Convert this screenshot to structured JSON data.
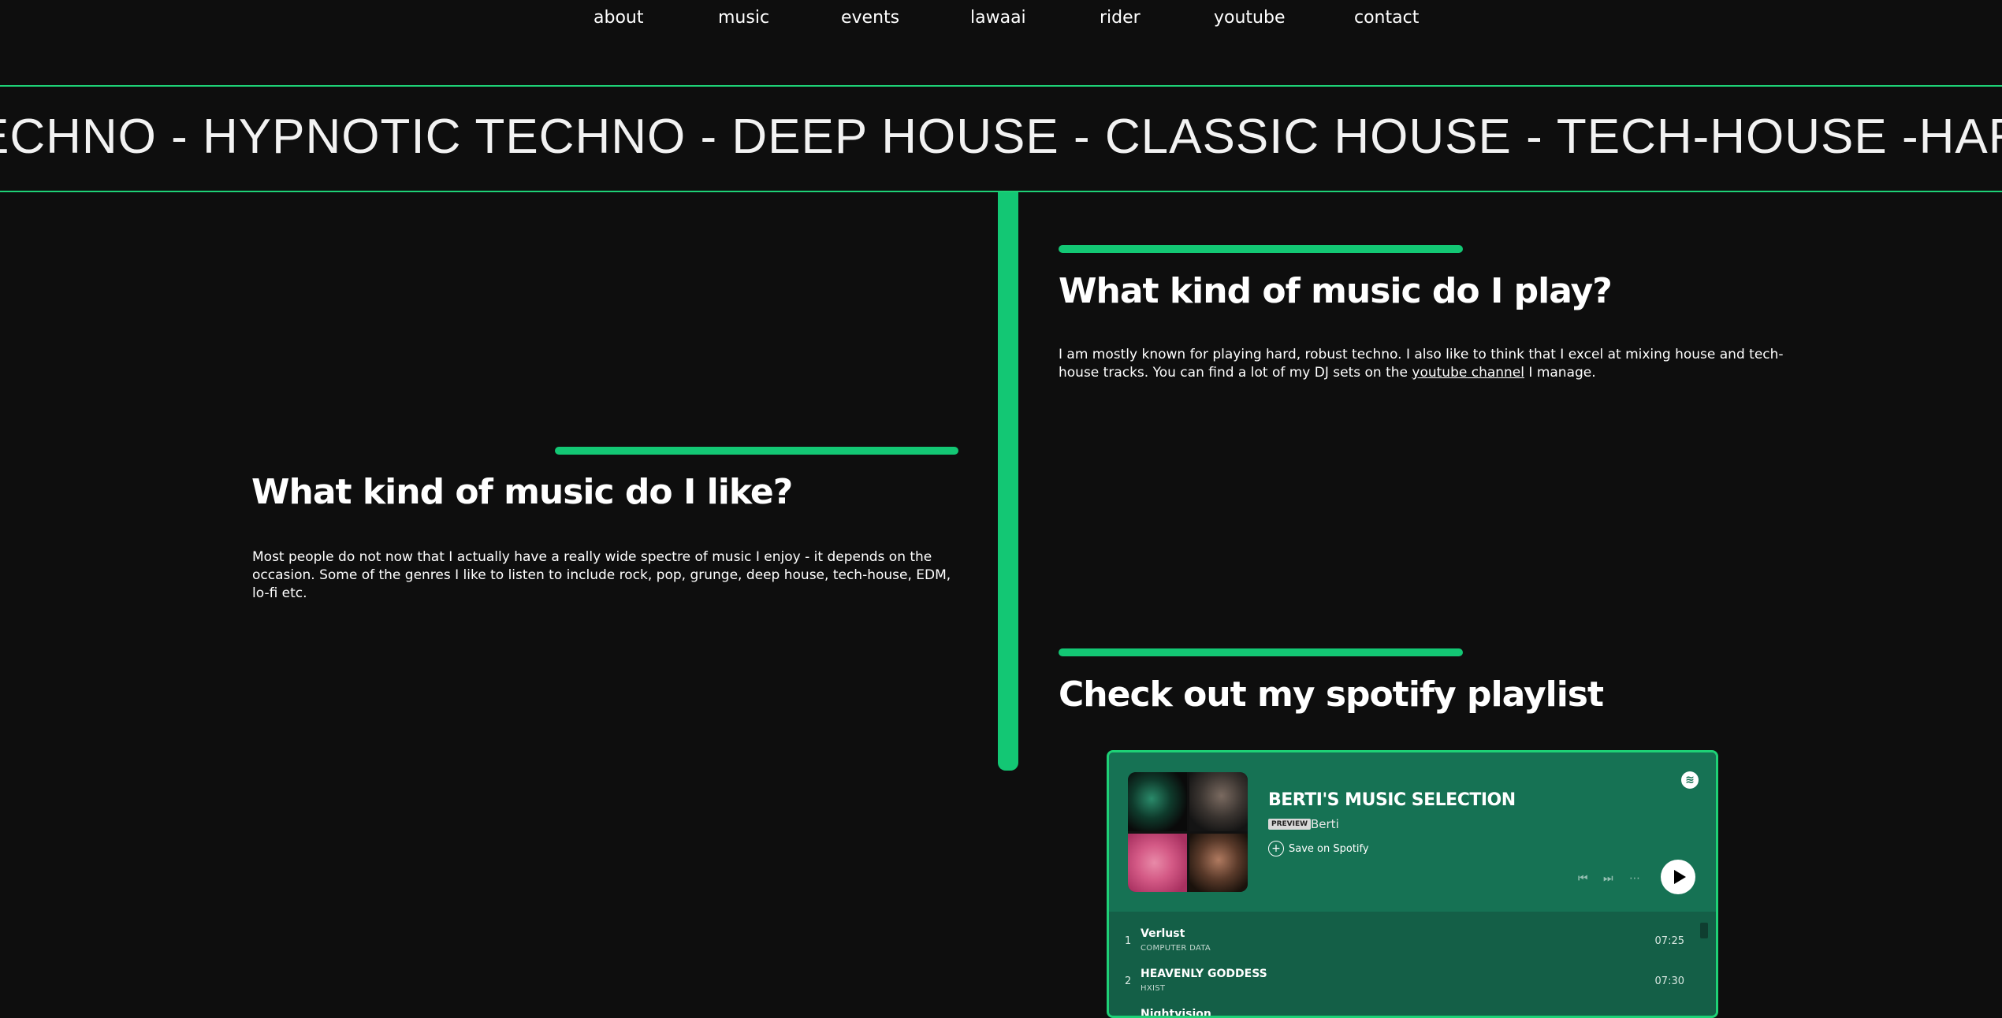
{
  "nav": {
    "items": [
      "about",
      "music",
      "events",
      "lawaai",
      "rider",
      "youtube",
      "contact"
    ]
  },
  "marquee": {
    "text": "ECHNO - HYPNOTIC TECHNO - DEEP HOUSE - CLASSIC HOUSE - TECH-HOUSE -HARD TECHNO - HYPNOTIC TECHNO"
  },
  "play": {
    "heading": "What kind of music do I play?",
    "text_1": "I am mostly known for playing hard, robust techno. I also like to think that I excel at mixing house and tech-house tracks. You can find a lot of my DJ sets on the ",
    "link": "youtube channel",
    "text_2": " I manage."
  },
  "like": {
    "heading": "What kind of music do I like?",
    "text": "Most people do not now that I actually have a really wide spectre of music I enjoy - it depends on the occasion. Some of the genres I like to listen to include rock, pop, grunge, deep house, tech-house, EDM, lo-fi etc."
  },
  "spotify_section": {
    "heading": "Check out my spotify playlist"
  },
  "spotify": {
    "playlist_title": "BERTI'S MUSIC SELECTION",
    "preview_badge": "PREVIEW",
    "owner": "Berti",
    "save_label": "Save on Spotify",
    "tracks": [
      {
        "num": "1",
        "title": "Verlust",
        "artist": "COMPUTER DATA",
        "duration": "07:25"
      },
      {
        "num": "2",
        "title": "HEAVENLY GODDESS",
        "artist": "HXIST",
        "duration": "07:30"
      },
      {
        "num": "",
        "title": "Nightvision",
        "artist": "",
        "duration": ""
      }
    ]
  },
  "colors": {
    "background": "#0e0e0e",
    "accent": "#13c774",
    "spotify_green": "#167254"
  }
}
